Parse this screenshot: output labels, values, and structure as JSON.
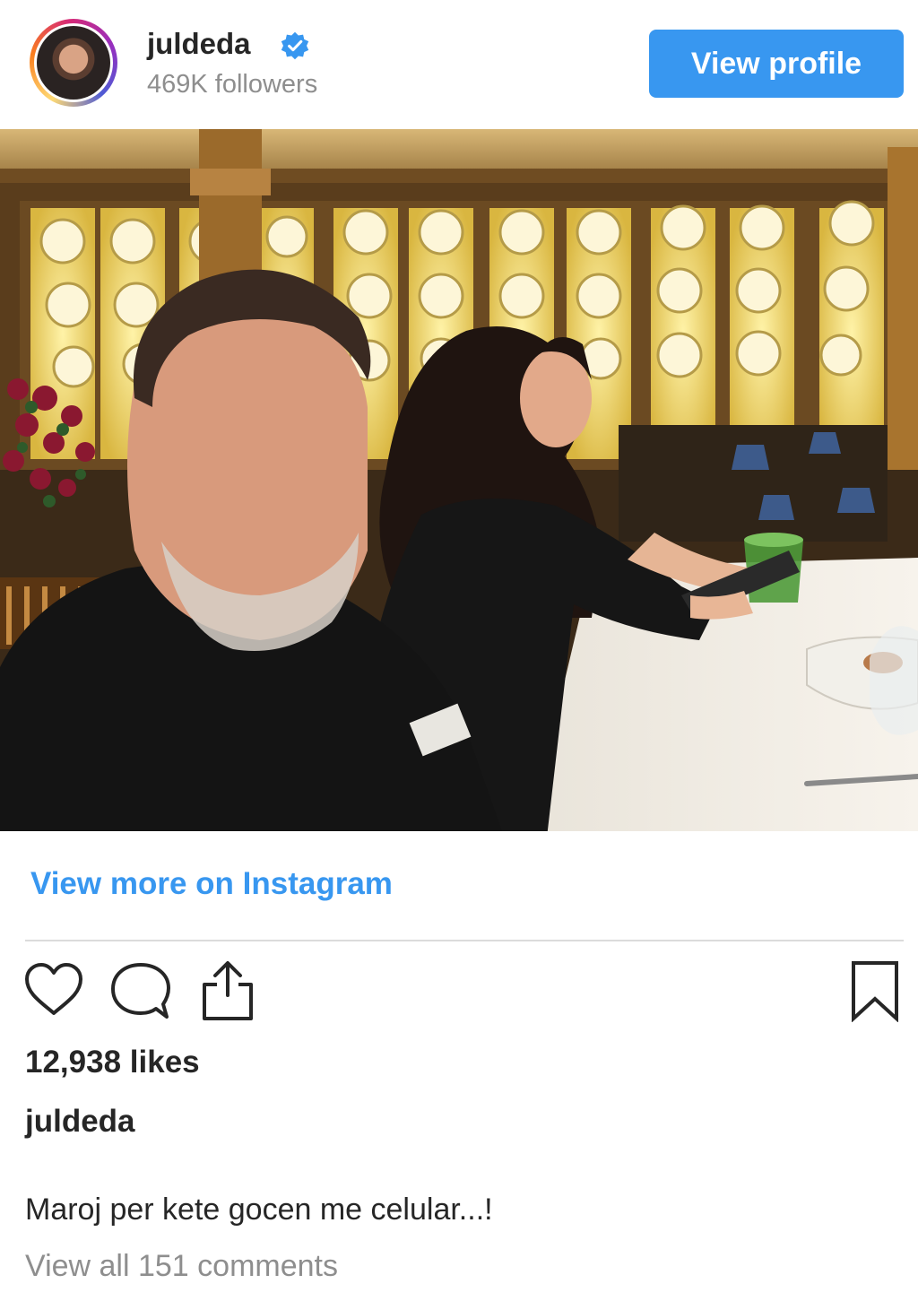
{
  "header": {
    "username": "juldeda",
    "followers": "469K followers",
    "view_profile_label": "View profile"
  },
  "post": {
    "photo_description_icon": "photo",
    "view_more_label": "View more on Instagram",
    "likes": "12,938 likes",
    "caption_user": "juldeda",
    "caption_text": "Maroj per kete gocen me celular...!",
    "comments_link": "View all 151 comments"
  },
  "icons": {
    "like": "heart-icon",
    "comment": "comment-icon",
    "share": "share-icon",
    "save": "bookmark-icon",
    "verified": "verified-badge-icon"
  },
  "colors": {
    "accent": "#3897f0",
    "text": "#262626",
    "muted": "#8e8e8e",
    "divider": "#dbdbdb"
  }
}
